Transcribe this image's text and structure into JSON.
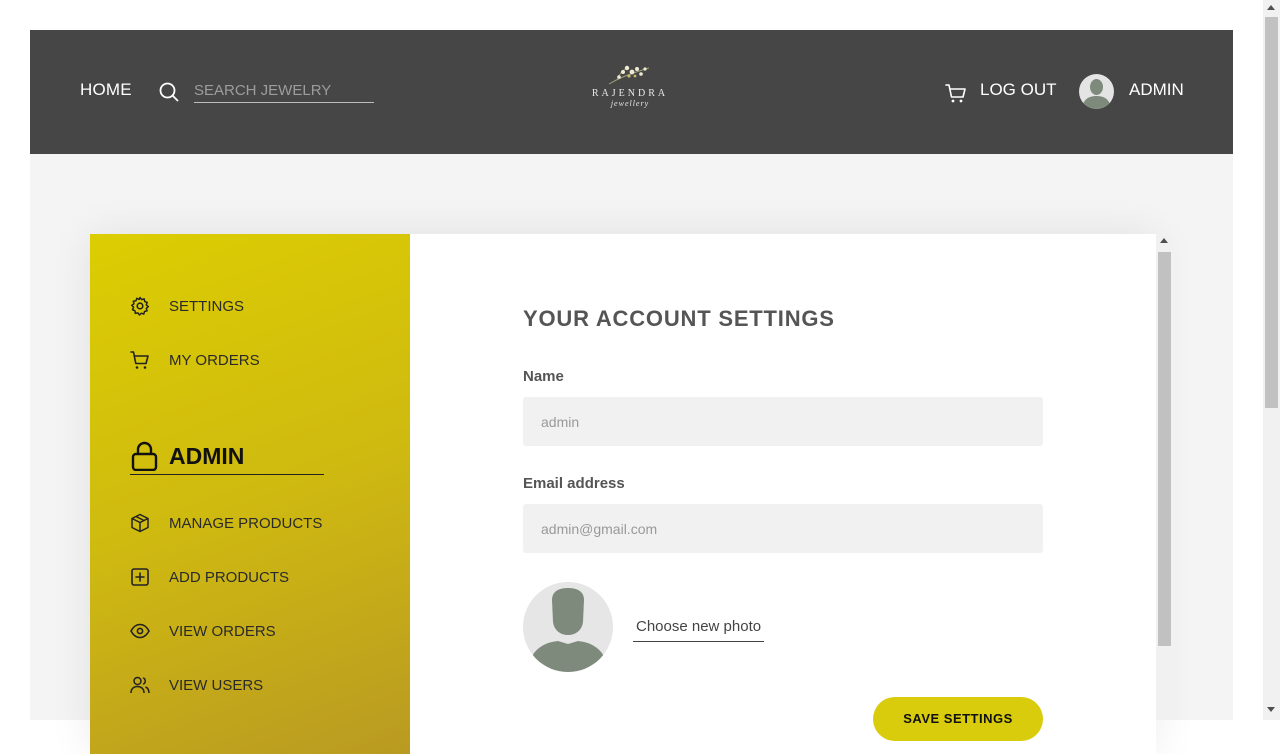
{
  "navbar": {
    "home_label": "HOME",
    "search_placeholder": "SEARCH JEWELRY",
    "search_icon": "search-icon",
    "logo_name": "RAJENDRA",
    "logo_sub": "jewellery",
    "cart_icon": "cart-icon",
    "logout_label": "LOG OUT",
    "admin_label": "ADMIN",
    "background": "#464646"
  },
  "sidebar": {
    "items": [
      {
        "label": "SETTINGS",
        "icon": "gear-icon"
      },
      {
        "label": "MY ORDERS",
        "icon": "cart-icon"
      }
    ],
    "admin_heading": "ADMIN",
    "admin_icon": "lock-icon",
    "admin_items": [
      {
        "label": "MANAGE PRODUCTS",
        "icon": "box-icon"
      },
      {
        "label": "ADD PRODUCTS",
        "icon": "plus-square-icon"
      },
      {
        "label": "VIEW ORDERS",
        "icon": "eye-icon"
      },
      {
        "label": "VIEW USERS",
        "icon": "users-icon"
      }
    ],
    "gradient": [
      "#dccd02",
      "#b99a22"
    ]
  },
  "settings": {
    "title": "YOUR ACCOUNT SETTINGS",
    "name_label": "Name",
    "name_placeholder": "admin",
    "email_label": "Email address",
    "email_placeholder": "admin@gmail.com",
    "choose_photo": "Choose new photo",
    "save_label": "SAVE SETTINGS",
    "accent": "#d8cc0c"
  }
}
